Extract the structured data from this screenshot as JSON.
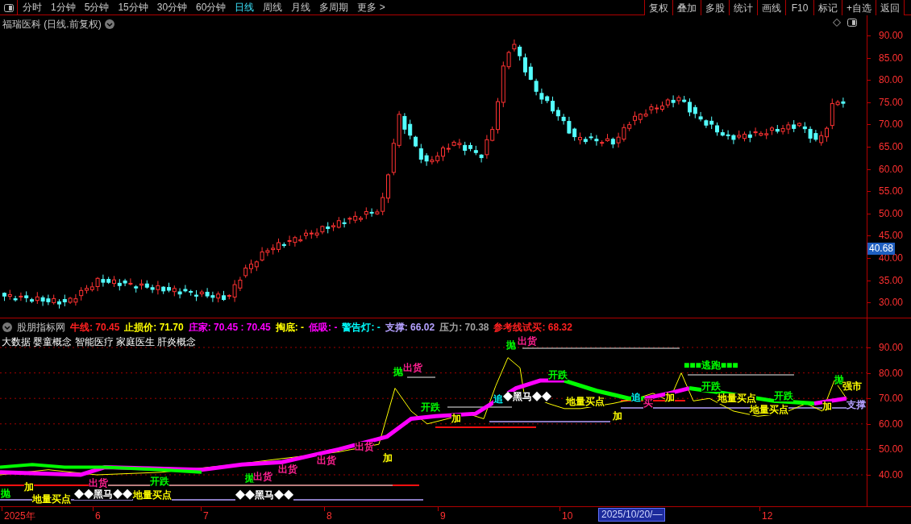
{
  "toolbar": {
    "periods": [
      {
        "label": "分时",
        "selected": false
      },
      {
        "label": "1分钟",
        "selected": false
      },
      {
        "label": "5分钟",
        "selected": false
      },
      {
        "label": "15分钟",
        "selected": false
      },
      {
        "label": "30分钟",
        "selected": false
      },
      {
        "label": "60分钟",
        "selected": false
      },
      {
        "label": "日线",
        "selected": true
      },
      {
        "label": "周线",
        "selected": false
      },
      {
        "label": "月线",
        "selected": false
      },
      {
        "label": "多周期",
        "selected": false
      },
      {
        "label": "更多 >",
        "selected": false
      }
    ],
    "buttons": [
      "复权",
      "叠加",
      "多股",
      "统计",
      "画线",
      "F10",
      "标记",
      "+自选",
      "返回"
    ]
  },
  "main_chart": {
    "title": "福瑞医科 (日线.前复权)",
    "y_axis": [
      "90.00",
      "85.00",
      "80.00",
      "75.00",
      "70.00",
      "65.00",
      "60.00",
      "55.00",
      "50.00",
      "45.00",
      "40.00",
      "35.00",
      "30.00"
    ],
    "price_tag": "40.68"
  },
  "indicator": {
    "name": "股朋指标网",
    "readouts": [
      {
        "text": "牛线: 70.45",
        "color": "#ff2020"
      },
      {
        "text": "止损价: 71.70",
        "color": "#ffff00"
      },
      {
        "text": "庄家: 70.45 : 70.45",
        "color": "#ff00ff"
      },
      {
        "text": "掏底: -",
        "color": "#ffff00"
      },
      {
        "text": "低吸: -",
        "color": "#ff00ff"
      },
      {
        "text": "警告灯: -",
        "color": "#00ffff"
      },
      {
        "text": "支撑: 66.02",
        "color": "#b4a0ff"
      },
      {
        "text": "压力: 70.38",
        "color": "#a0a0a0"
      },
      {
        "text": "参考线试买: 68.32",
        "color": "#ff2020"
      }
    ],
    "concepts": "大数据 婴童概念 智能医疗 家庭医生 肝炎概念",
    "y_axis": [
      "90.00",
      "80.00",
      "70.00",
      "60.00",
      "50.00",
      "40.00"
    ],
    "signals": [
      {
        "text": "抛",
        "color": "#00ff00"
      },
      {
        "text": "加",
        "color": "#ffff00"
      },
      {
        "text": "出货",
        "color": "#ff2090"
      },
      {
        "text": "◆◆黑马◆◆",
        "color": "#ffffff"
      },
      {
        "text": "地量买点",
        "color": "#ffff00"
      },
      {
        "text": "开跌",
        "color": "#00ff00"
      },
      {
        "text": "地量买点",
        "color": "#ffff00"
      },
      {
        "text": "◆◆黑马◆◆",
        "color": "#ffffff"
      },
      {
        "text": "抛",
        "color": "#00ff00"
      },
      {
        "text": "出货",
        "color": "#ff2090"
      },
      {
        "text": "出货",
        "color": "#ff2090"
      },
      {
        "text": "出货",
        "color": "#ff2090"
      },
      {
        "text": "出货",
        "color": "#ff2090"
      },
      {
        "text": "加",
        "color": "#ffff00"
      },
      {
        "text": "抛",
        "color": "#00ff00"
      },
      {
        "text": "出货",
        "color": "#ff2090"
      },
      {
        "text": "开跌",
        "color": "#00ff00"
      },
      {
        "text": "加",
        "color": "#ffff00"
      },
      {
        "text": "抛",
        "color": "#00ff00"
      },
      {
        "text": "出货",
        "color": "#ff2090"
      },
      {
        "text": "追",
        "color": "#00ffff"
      },
      {
        "text": "◆黑马◆◆",
        "color": "#ffffff"
      },
      {
        "text": "开跌",
        "color": "#00ff00"
      },
      {
        "text": "地量买点",
        "color": "#ffff00"
      },
      {
        "text": "加",
        "color": "#ffff00"
      },
      {
        "text": "追",
        "color": "#00ffff"
      },
      {
        "text": "买",
        "color": "#ff2090"
      },
      {
        "text": "加",
        "color": "#ffff00"
      },
      {
        "text": "■■■逃跑■■■",
        "color": "#00ff00"
      },
      {
        "text": "开跌",
        "color": "#00ff00"
      },
      {
        "text": "地量买点",
        "color": "#ffff00"
      },
      {
        "text": "地量买点",
        "color": "#ffff00"
      },
      {
        "text": "开跌",
        "color": "#00ff00"
      },
      {
        "text": "加",
        "color": "#ffff00"
      },
      {
        "text": "抛",
        "color": "#00ff00"
      },
      {
        "text": "强市",
        "color": "#ffff00"
      },
      {
        "text": "支撑",
        "color": "#b4a0ff"
      }
    ]
  },
  "date_axis": {
    "labels": [
      "2025年",
      "6",
      "7",
      "8",
      "9",
      "10",
      "12"
    ],
    "cursor_date": "2025/10/20/—"
  }
}
